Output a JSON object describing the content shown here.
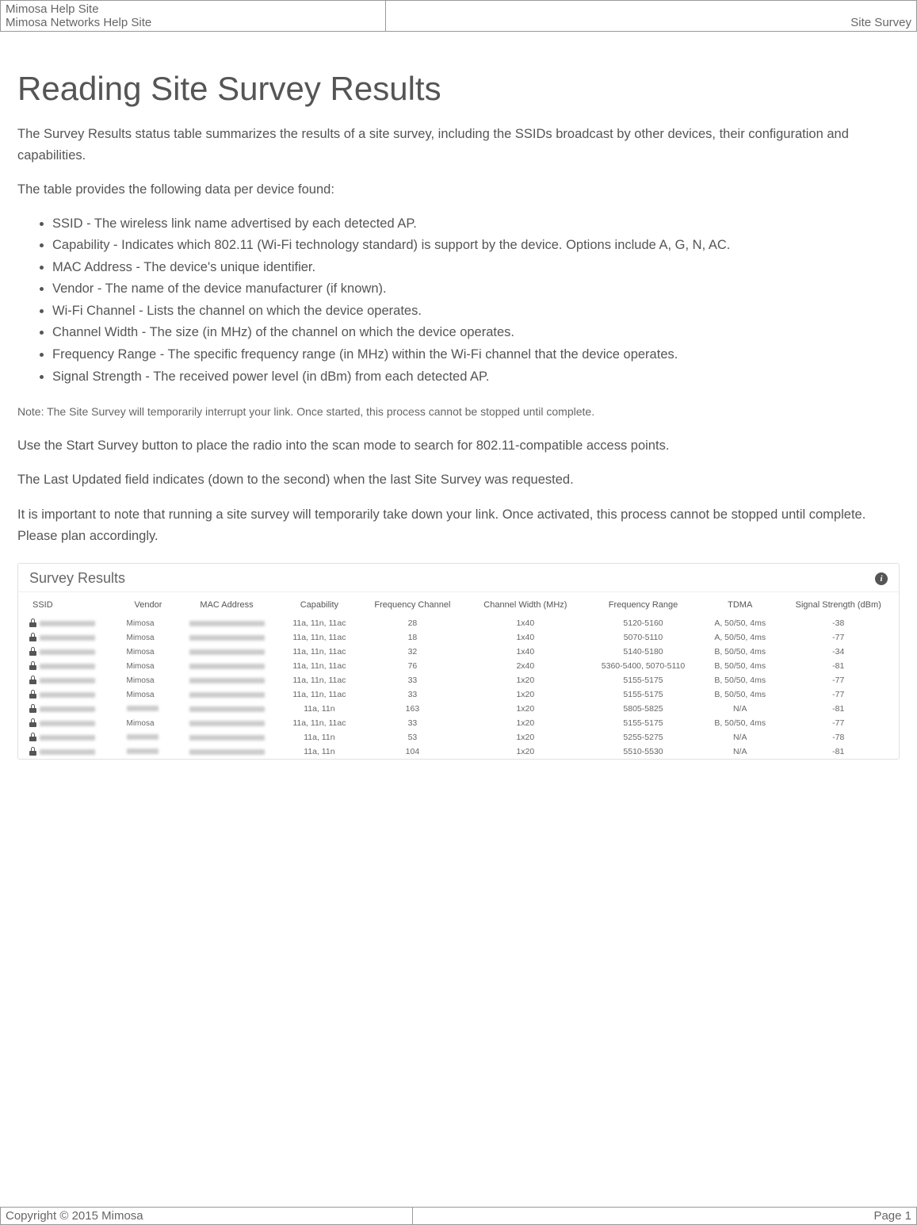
{
  "header": {
    "line1": "Mimosa Help Site",
    "line2": "Mimosa Networks Help Site",
    "right": "Site Survey"
  },
  "page": {
    "title": "Reading Site Survey Results",
    "intro": "The Survey Results status table summarizes the results of a site survey, including the SSIDs broadcast by other devices, their configuration and capabilities.",
    "table_intro": "The table provides the following data per device found:",
    "bullets": [
      "SSID - The wireless link name advertised by each detected AP.",
      "Capability - Indicates which 802.11 (Wi-Fi technology standard) is support by the device. Options include A, G, N, AC.",
      "MAC Address - The device's unique identifier.",
      "Vendor - The name of the device manufacturer (if known).",
      "Wi-Fi Channel - Lists the channel on which the device operates.",
      "Channel Width - The size (in MHz) of the channel on which the device operates.",
      "Frequency Range - The specific frequency range (in MHz) within the Wi-Fi channel that the device operates.",
      "Signal Strength - The received power level (in dBm) from each detected AP."
    ],
    "note": "Note: The Site Survey will temporarily interrupt your link. Once started, this process cannot be stopped until complete.",
    "para1": "Use the Start Survey button to place the radio into the scan mode to search for 802.11-compatible access points.",
    "para2": "The Last Updated field indicates (down to the second) when the last Site Survey was requested.",
    "para3": "It is important to note that running a site survey will temporarily take down your link. Once activated, this process cannot be stopped until complete. Please plan accordingly."
  },
  "survey": {
    "panel_title": "Survey Results",
    "columns": {
      "ssid": "SSID",
      "vendor": "Vendor",
      "mac": "MAC Address",
      "capability": "Capability",
      "freq_channel": "Frequency Channel",
      "channel_width": "Channel Width (MHz)",
      "freq_range": "Frequency Range",
      "tdma": "TDMA",
      "signal": "Signal Strength (dBm)"
    },
    "rows": [
      {
        "vendor": "Mimosa",
        "capability": "11a, 11n, 11ac",
        "channel": "28",
        "width": "1x40",
        "range": "5120-5160",
        "tdma": "A, 50/50, 4ms",
        "signal": "-38"
      },
      {
        "vendor": "Mimosa",
        "capability": "11a, 11n, 11ac",
        "channel": "18",
        "width": "1x40",
        "range": "5070-5110",
        "tdma": "A, 50/50, 4ms",
        "signal": "-77"
      },
      {
        "vendor": "Mimosa",
        "capability": "11a, 11n, 11ac",
        "channel": "32",
        "width": "1x40",
        "range": "5140-5180",
        "tdma": "B, 50/50, 4ms",
        "signal": "-34"
      },
      {
        "vendor": "Mimosa",
        "capability": "11a, 11n, 11ac",
        "channel": "76",
        "width": "2x40",
        "range": "5360-5400, 5070-5110",
        "tdma": "B, 50/50, 4ms",
        "signal": "-81"
      },
      {
        "vendor": "Mimosa",
        "capability": "11a, 11n, 11ac",
        "channel": "33",
        "width": "1x20",
        "range": "5155-5175",
        "tdma": "B, 50/50, 4ms",
        "signal": "-77"
      },
      {
        "vendor": "Mimosa",
        "capability": "11a, 11n, 11ac",
        "channel": "33",
        "width": "1x20",
        "range": "5155-5175",
        "tdma": "B, 50/50, 4ms",
        "signal": "-77"
      },
      {
        "vendor": "",
        "capability": "11a, 11n",
        "channel": "163",
        "width": "1x20",
        "range": "5805-5825",
        "tdma": "N/A",
        "signal": "-81"
      },
      {
        "vendor": "Mimosa",
        "capability": "11a, 11n, 11ac",
        "channel": "33",
        "width": "1x20",
        "range": "5155-5175",
        "tdma": "B, 50/50, 4ms",
        "signal": "-77"
      },
      {
        "vendor": "",
        "capability": "11a, 11n",
        "channel": "53",
        "width": "1x20",
        "range": "5255-5275",
        "tdma": "N/A",
        "signal": "-78"
      },
      {
        "vendor": "",
        "capability": "11a, 11n",
        "channel": "104",
        "width": "1x20",
        "range": "5510-5530",
        "tdma": "N/A",
        "signal": "-81"
      }
    ]
  },
  "footer": {
    "copyright": "Copyright © 2015 Mimosa",
    "page": "Page 1"
  }
}
